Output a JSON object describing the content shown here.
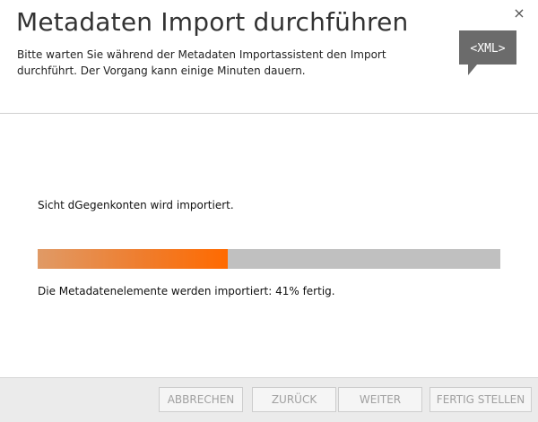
{
  "window": {
    "title": "Metadaten Import durchführen",
    "subtitle": "Bitte warten Sie während der Metadaten Importassistent den Import durchführt. Der Vorgang kann einige Minuten dauern.",
    "close_symbol": "×",
    "xml_icon_label": "<XML>"
  },
  "content": {
    "status_text": "Sicht dGegenkonten wird importiert.",
    "progress_percent": 41,
    "progress_text": "Die Metadatenelemente werden importiert: 41% fertig."
  },
  "footer": {
    "cancel_label": "ABBRECHEN",
    "back_label": "ZURÜCK",
    "next_label": "WEITER",
    "finish_label": "FERTIG STELLEN"
  },
  "colors": {
    "progress_fill": "#ff6a00",
    "progress_track": "#c0c0c0",
    "icon_bubble": "#6b6b6b"
  },
  "icons": {
    "close": "close-icon",
    "xml": "xml-speech-bubble-icon"
  }
}
